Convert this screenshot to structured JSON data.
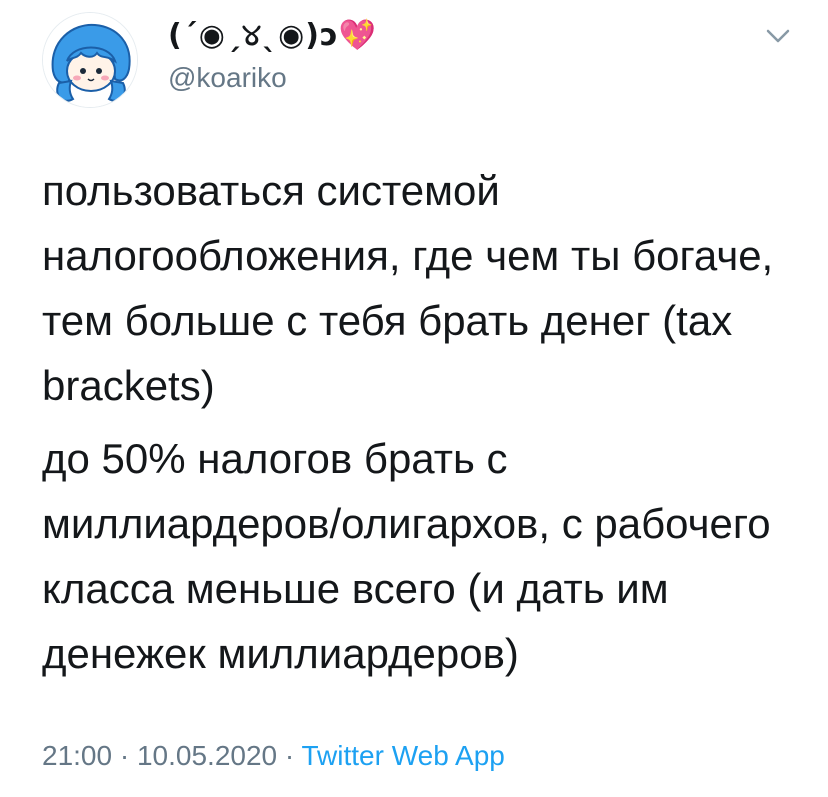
{
  "author": {
    "display_name": "(´◉ˏ୪ˎ◉)ɔ💖",
    "handle": "@koariko",
    "avatar": "avatar-blue-hair-character"
  },
  "menu": {
    "icon": "chevron-down-icon"
  },
  "tweet": {
    "paragraph_1": "пользоваться системой налогообложения, где чем ты богаче, тем больше с тебя брать денег (tax brackets)",
    "paragraph_2": "до 50% налогов брать с миллиардеров/олигархов, с рабочего класса меньше всего (и дать им денежек миллиардеров)"
  },
  "meta": {
    "time": "21:00",
    "separator_1": " · ",
    "date": "10.05.2020",
    "separator_2": " · ",
    "source": "Twitter Web App"
  },
  "colors": {
    "text": "#14171a",
    "secondary": "#657786",
    "link": "#1da1f2",
    "avatar_hair": "#3a9be8"
  }
}
